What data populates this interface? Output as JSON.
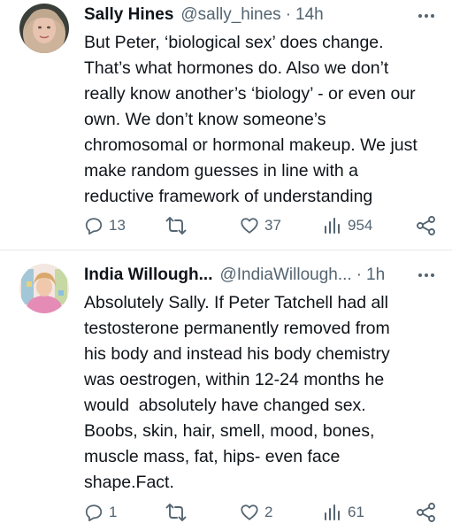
{
  "tweets": [
    {
      "author_name": "Sally Hines",
      "handle": "@sally_hines",
      "separator": "·",
      "time": "14h",
      "text_lines": [
        "But Peter, ‘biological sex’ does change.",
        "That’s what hormones do. Also we don’t",
        "really know another’s ‘biology’ - or even our",
        "own. We don’t know someone’s",
        "chromosomal or hormonal makeup. We just",
        "make random guesses in line with a",
        "reductive framework of understanding"
      ],
      "replies": "13",
      "retweets": "",
      "likes": "37",
      "views": "954"
    },
    {
      "author_name": "India Willough...",
      "handle": "@IndiaWillough...",
      "separator": "·",
      "time": "1h",
      "text_lines": [
        "Absolutely Sally. If Peter Tatchell had all",
        "testosterone permanently removed from",
        "his body and instead his body chemistry",
        "was oestrogen, within 12-24 months he",
        "would  absolutely have changed sex.",
        "Boobs, skin, hair, smell, mood, bones,",
        "muscle mass, fat, hips- even face",
        "shape.Fact."
      ],
      "replies": "1",
      "retweets": "",
      "likes": "2",
      "views": "61"
    }
  ],
  "icons": {
    "more": "more-dots-icon",
    "reply": "reply-bubble-icon",
    "retweet": "retweet-icon",
    "like": "heart-icon",
    "views": "views-chart-icon",
    "share": "share-icon"
  },
  "colors": {
    "text": "#0f1419",
    "secondary": "#536471",
    "divider": "#e6e9ec"
  }
}
